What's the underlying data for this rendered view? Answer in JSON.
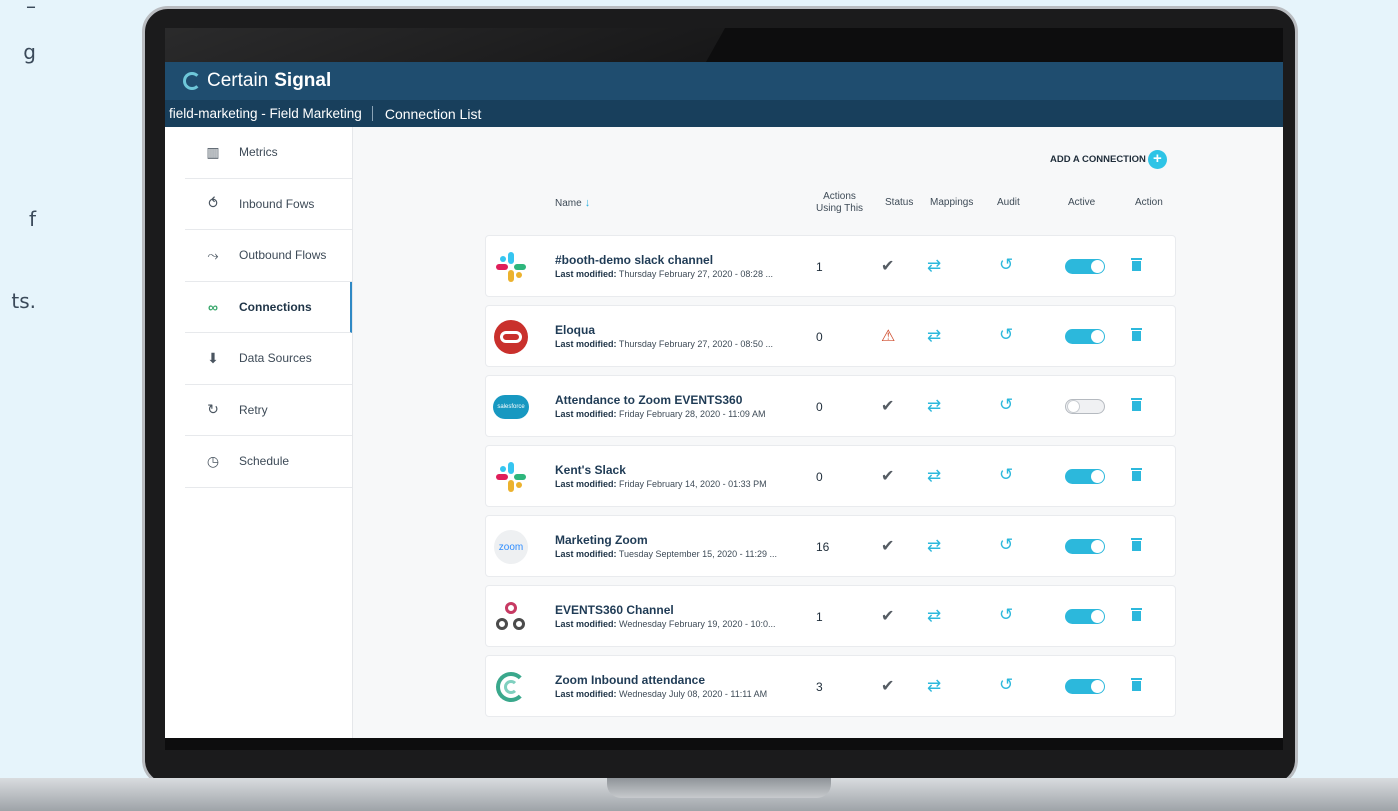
{
  "brand": {
    "name_light": "Certain",
    "name_bold": "Signal"
  },
  "context": {
    "workspace": "field-marketing - Field Marketing",
    "breadcrumb": "Connection List"
  },
  "sidebar": {
    "items": [
      {
        "label": "Metrics",
        "icon": "bar-chart-icon"
      },
      {
        "label": "Inbound Fows",
        "icon": "inbound-icon"
      },
      {
        "label": "Outbound Flows",
        "icon": "outbound-icon"
      },
      {
        "label": "Connections",
        "icon": "link-icon",
        "active": true
      },
      {
        "label": "Data Sources",
        "icon": "arrow-down-icon"
      },
      {
        "label": "Retry",
        "icon": "retry-icon"
      },
      {
        "label": "Schedule",
        "icon": "clock-icon"
      }
    ]
  },
  "toolbar": {
    "add_label": "ADD A CONNECTION"
  },
  "table": {
    "headers": {
      "name": "Name",
      "actions": [
        "Actions",
        "Using This"
      ],
      "status": "Status",
      "mappings": "Mappings",
      "audit": "Audit",
      "active": "Active",
      "action": "Action"
    },
    "modified_label": "Last modified:",
    "rows": [
      {
        "name": "#booth-demo slack channel",
        "modified": "Thursday February 27, 2020 - 08:28 ...",
        "count": "1",
        "status": "ok",
        "active": true,
        "logo": "slack"
      },
      {
        "name": "Eloqua",
        "modified": "Thursday February 27, 2020 - 08:50 ...",
        "count": "0",
        "status": "warning",
        "active": true,
        "logo": "oracle"
      },
      {
        "name": "Attendance to Zoom EVENTS360",
        "modified": "Friday February 28, 2020 - 11:09 AM",
        "count": "0",
        "status": "ok",
        "active": false,
        "logo": "salesforce",
        "logo_text": "salesforce"
      },
      {
        "name": "Kent's Slack",
        "modified": "Friday February 14, 2020 - 01:33 PM",
        "count": "0",
        "status": "ok",
        "active": true,
        "logo": "slack"
      },
      {
        "name": "Marketing Zoom",
        "modified": "Tuesday September 15, 2020 - 11:29 ...",
        "count": "16",
        "status": "ok",
        "active": true,
        "logo": "zoom",
        "logo_text": "zoom"
      },
      {
        "name": "EVENTS360 Channel",
        "modified": "Wednesday February 19, 2020 - 10:0...",
        "count": "1",
        "status": "ok",
        "active": true,
        "logo": "webhook"
      },
      {
        "name": "Zoom Inbound attendance",
        "modified": "Wednesday July 08, 2020 - 11:11 AM",
        "count": "3",
        "status": "ok",
        "active": true,
        "logo": "certain"
      }
    ]
  },
  "left_text_fragments": [
    "–",
    "g",
    "f",
    "ts."
  ],
  "colors": {
    "topbar": "#1f4d6f",
    "subbar": "#183f5c",
    "accent": "#2cb8dc",
    "warning": "#cf4b2c"
  }
}
